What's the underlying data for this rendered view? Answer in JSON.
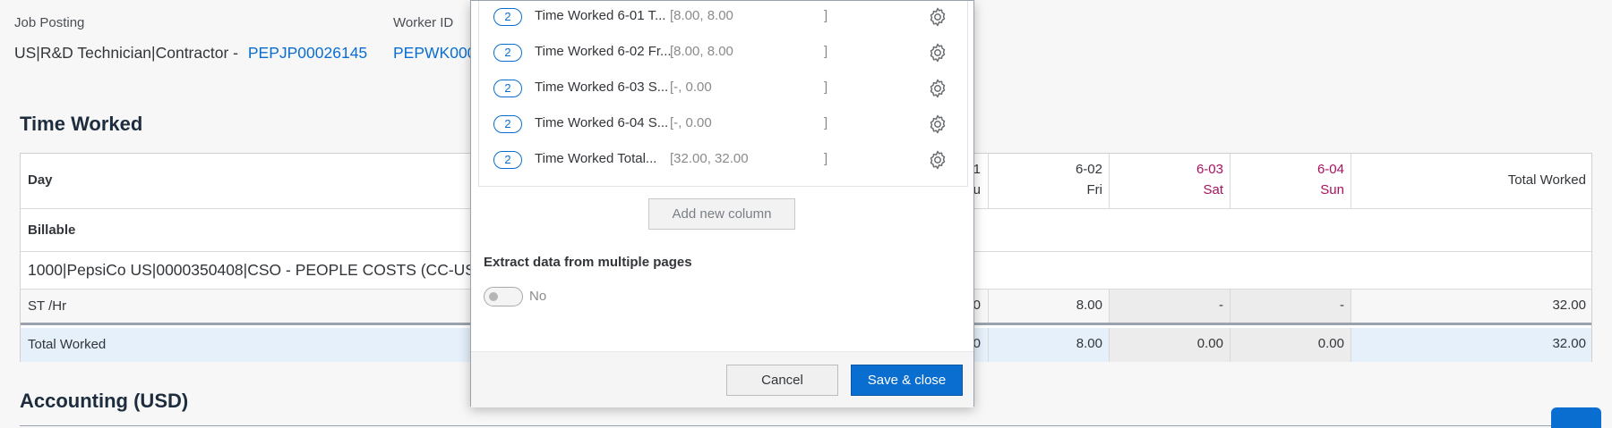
{
  "header": {
    "job_posting_label": "Job Posting",
    "job_posting_text": "US|R&D Technician|Contractor -",
    "job_posting_link": "PEPJP00026145",
    "worker_id_label": "Worker ID",
    "worker_id_value": "PEPWK000"
  },
  "time_worked": {
    "title": "Time Worked",
    "day_label": "Day",
    "columns": [
      {
        "date": "1",
        "weekday": "u"
      },
      {
        "date": "6-02",
        "weekday": "Fri"
      },
      {
        "date": "6-03",
        "weekday": "Sat"
      },
      {
        "date": "6-04",
        "weekday": "Sun"
      }
    ],
    "total_worked_header": "Total Worked",
    "billable_label": "Billable",
    "cost_center": "1000|PepsiCo US|0000350408|CSO - PEOPLE COSTS (CC-US",
    "st_hr_label": "ST /Hr",
    "st_hr_values": [
      "0",
      "8.00",
      "-",
      "-",
      "32.00"
    ],
    "total_label": "Total Worked",
    "total_values": [
      "0",
      "8.00",
      "0.00",
      "0.00",
      "32.00"
    ]
  },
  "accounting": {
    "title": "Accounting (USD)"
  },
  "dialog": {
    "items": [
      {
        "badge": "2",
        "name": "Time Worked 6-01 T...",
        "range": "[8.00, 8.00",
        "close": "]"
      },
      {
        "badge": "2",
        "name": "Time Worked 6-02 Fr...",
        "range": "[8.00, 8.00",
        "close": "]"
      },
      {
        "badge": "2",
        "name": "Time Worked 6-03 S...",
        "range": "[-, 0.00",
        "close": "]"
      },
      {
        "badge": "2",
        "name": "Time Worked 6-04 S...",
        "range": "[-, 0.00",
        "close": "]"
      },
      {
        "badge": "2",
        "name": "Time Worked Total...",
        "range": "[32.00, 32.00",
        "close": "]"
      }
    ],
    "add_column_label": "Add new column",
    "extract_label": "Extract data from multiple pages",
    "toggle_label": "No",
    "cancel_label": "Cancel",
    "save_label": "Save & close"
  },
  "colors": {
    "accent": "#0a6ed1",
    "weekend": "#a8125f",
    "total_row_bg": "#e5f0fa"
  }
}
